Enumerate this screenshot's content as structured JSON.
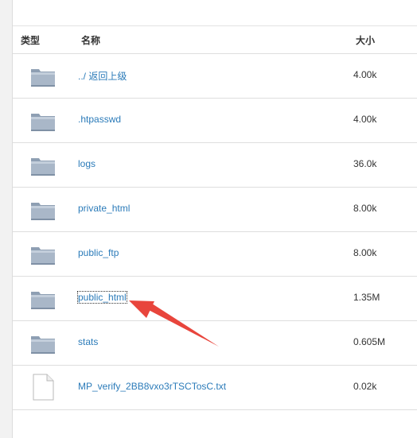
{
  "header": {
    "type_label": "类型",
    "name_label": "名称",
    "size_label": "大小"
  },
  "rows": [
    {
      "name": "../ 返回上级",
      "size": "4.00k",
      "kind": "folder"
    },
    {
      "name": ".htpasswd",
      "size": "4.00k",
      "kind": "folder"
    },
    {
      "name": "logs",
      "size": "36.0k",
      "kind": "folder"
    },
    {
      "name": "private_html",
      "size": "8.00k",
      "kind": "folder"
    },
    {
      "name": "public_ftp",
      "size": "8.00k",
      "kind": "folder"
    },
    {
      "name": "public_html",
      "size": "1.35M",
      "kind": "folder",
      "focused": true
    },
    {
      "name": "stats",
      "size": "0.605M",
      "kind": "folder"
    },
    {
      "name": "MP_verify_2BB8vxo3rTSCTosC.txt",
      "size": "0.02k",
      "kind": "file"
    }
  ],
  "icons": {
    "folder": "folder-icon",
    "file": "file-icon"
  },
  "colors": {
    "link": "#2b7bb9",
    "annotation_arrow": "#e8453c"
  }
}
